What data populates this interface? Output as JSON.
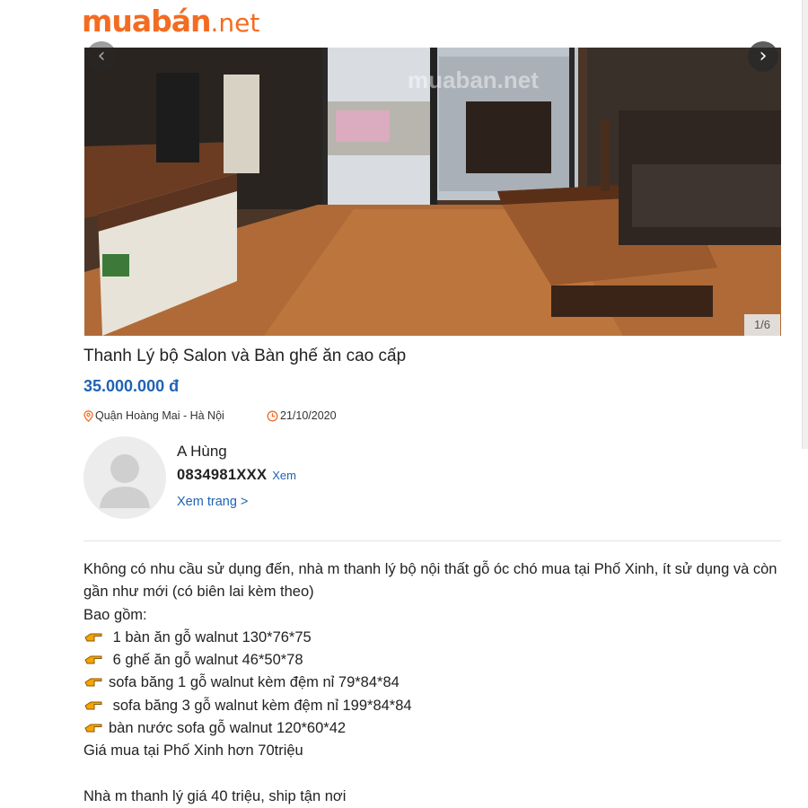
{
  "logo": {
    "main": "muabán",
    "suffix": ".net"
  },
  "gallery": {
    "prev_icon": "chevron-left-icon",
    "next_icon": "chevron-right-icon",
    "prev_glyph": "‹",
    "next_glyph": "›",
    "counter": "1/6",
    "watermark": "muaban.net"
  },
  "listing": {
    "title": "Thanh Lý bộ Salon và Bàn ghế ăn cao cấp",
    "price": "35.000.000 đ",
    "location": "Quận Hoàng Mai - Hà Nội",
    "date": "21/10/2020",
    "location_icon": "map-pin-icon",
    "date_icon": "clock-icon"
  },
  "seller": {
    "name": "A Hùng",
    "phone": "0834981XXX",
    "reveal_label": "Xem",
    "view_page_label": "Xem trang >"
  },
  "description": {
    "intro": "Không có nhu cầu sử dụng đến, nhà m thanh lý bộ nội thất gỗ óc chó mua tại Phố Xinh, ít sử dụng và còn gần như mới (có biên lai kèm theo)",
    "includes_label": "Bao gồm:",
    "items": [
      " 1 bàn ăn gỗ walnut 130*76*75",
      " 6 ghế ăn gỗ walnut 46*50*78",
      "sofa băng 1 gỗ walnut kèm đệm nỉ 79*84*84",
      " sofa băng 3 gỗ walnut kèm đệm nỉ 199*84*84",
      "bàn nước sofa gỗ walnut 120*60*42"
    ],
    "purchase_price": "Giá mua tại Phố Xinh hơn 70triệu",
    "sale_note": "Nhà m thanh lý giá 40 triệu, ship tận nơi",
    "bullet_icon": "pointing-hand-icon"
  },
  "colors": {
    "brand": "#f36c21",
    "link": "#1f63b4"
  }
}
